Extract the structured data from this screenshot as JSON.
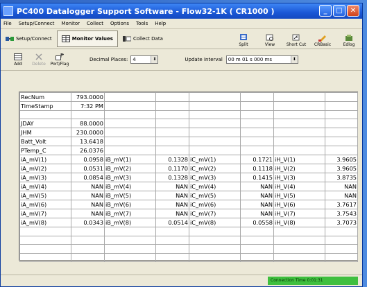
{
  "window": {
    "title": "PC400 Datalogger Support Software - Flow32-1K ( CR1000 )"
  },
  "menu": [
    "File",
    "Setup/Connect",
    "Monitor",
    "Collect",
    "Options",
    "Tools",
    "Help"
  ],
  "tabs": [
    {
      "label": "Setup/Connect",
      "active": false
    },
    {
      "label": "Monitor Values",
      "active": true
    },
    {
      "label": "Collect Data",
      "active": false
    }
  ],
  "right_tools": [
    {
      "label": "Split",
      "icon": "split-icon"
    },
    {
      "label": "View",
      "icon": "view-icon"
    },
    {
      "label": "Short Cut",
      "icon": "shortcut-icon"
    },
    {
      "label": "CRBasic",
      "icon": "crbasic-icon"
    },
    {
      "label": "Edlog",
      "icon": "edlog-icon"
    }
  ],
  "monitor_toolbar": {
    "add_label": "Add",
    "delete_label": "Delete",
    "portflag_label": "Port/Flag",
    "decimal_label": "Decimal Places:",
    "decimal_value": "4",
    "update_label": "Update Interval",
    "update_value": "00 m 01 s 000 ms"
  },
  "grid": {
    "rows": [
      [
        {
          "n": "RecNum",
          "v": "793.0000"
        },
        {
          "n": "",
          "v": ""
        },
        {
          "n": "",
          "v": ""
        },
        {
          "n": "",
          "v": ""
        }
      ],
      [
        {
          "n": "TimeStamp",
          "v": "7:32 PM"
        },
        {
          "n": "",
          "v": ""
        },
        {
          "n": "",
          "v": ""
        },
        {
          "n": "",
          "v": ""
        }
      ],
      [
        {
          "n": "",
          "v": ""
        },
        {
          "n": "",
          "v": ""
        },
        {
          "n": "",
          "v": ""
        },
        {
          "n": "",
          "v": ""
        }
      ],
      [
        {
          "n": "JDAY",
          "v": "88.0000"
        },
        {
          "n": "",
          "v": ""
        },
        {
          "n": "",
          "v": ""
        },
        {
          "n": "",
          "v": ""
        }
      ],
      [
        {
          "n": "JHM",
          "v": "230.0000"
        },
        {
          "n": "",
          "v": ""
        },
        {
          "n": "",
          "v": ""
        },
        {
          "n": "",
          "v": ""
        }
      ],
      [
        {
          "n": "Batt_Volt",
          "v": "13.6418"
        },
        {
          "n": "",
          "v": ""
        },
        {
          "n": "",
          "v": ""
        },
        {
          "n": "",
          "v": ""
        }
      ],
      [
        {
          "n": "PTemp_C",
          "v": "26.0376"
        },
        {
          "n": "",
          "v": ""
        },
        {
          "n": "",
          "v": ""
        },
        {
          "n": "",
          "v": ""
        }
      ],
      [
        {
          "n": "iA_mV(1)",
          "v": "0.0958"
        },
        {
          "n": "iB_mV(1)",
          "v": "0.1328"
        },
        {
          "n": "iC_mV(1)",
          "v": "0.1721"
        },
        {
          "n": "iH_V(1)",
          "v": "3.9605"
        }
      ],
      [
        {
          "n": "iA_mV(2)",
          "v": "0.0531"
        },
        {
          "n": "iB_mV(2)",
          "v": "0.1170"
        },
        {
          "n": "iC_mV(2)",
          "v": "0.1118"
        },
        {
          "n": "iH_V(2)",
          "v": "3.9605"
        }
      ],
      [
        {
          "n": "iA_mV(3)",
          "v": "0.0854"
        },
        {
          "n": "iB_mV(3)",
          "v": "0.1328"
        },
        {
          "n": "iC_mV(3)",
          "v": "0.1415"
        },
        {
          "n": "iH_V(3)",
          "v": "3.8735"
        }
      ],
      [
        {
          "n": "iA_mV(4)",
          "v": "NAN"
        },
        {
          "n": "iB_mV(4)",
          "v": "NAN"
        },
        {
          "n": "iC_mV(4)",
          "v": "NAN"
        },
        {
          "n": "iH_V(4)",
          "v": "NAN"
        }
      ],
      [
        {
          "n": "iA_mV(5)",
          "v": "NAN"
        },
        {
          "n": "iB_mV(5)",
          "v": "NAN"
        },
        {
          "n": "iC_mV(5)",
          "v": "NAN"
        },
        {
          "n": "iH_V(5)",
          "v": "NAN"
        }
      ],
      [
        {
          "n": "iA_mV(6)",
          "v": "NAN"
        },
        {
          "n": "iB_mV(6)",
          "v": "NAN"
        },
        {
          "n": "iC_mV(6)",
          "v": "NAN"
        },
        {
          "n": "iH_V(6)",
          "v": "3.7617"
        }
      ],
      [
        {
          "n": "iA_mV(7)",
          "v": "NAN"
        },
        {
          "n": "iB_mV(7)",
          "v": "NAN"
        },
        {
          "n": "iC_mV(7)",
          "v": "NAN"
        },
        {
          "n": "iH_V(7)",
          "v": "3.7543"
        }
      ],
      [
        {
          "n": "iA_mV(8)",
          "v": "0.0343"
        },
        {
          "n": "iB_mV(8)",
          "v": "0.0514"
        },
        {
          "n": "iC_mV(8)",
          "v": "0.0558"
        },
        {
          "n": "iH_V(8)",
          "v": "3.7073"
        }
      ],
      [
        {
          "n": "",
          "v": ""
        },
        {
          "n": "",
          "v": ""
        },
        {
          "n": "",
          "v": ""
        },
        {
          "n": "",
          "v": ""
        }
      ],
      [
        {
          "n": "",
          "v": ""
        },
        {
          "n": "",
          "v": ""
        },
        {
          "n": "",
          "v": ""
        },
        {
          "n": "",
          "v": ""
        }
      ],
      [
        {
          "n": "",
          "v": ""
        },
        {
          "n": "",
          "v": ""
        },
        {
          "n": "",
          "v": ""
        },
        {
          "n": "",
          "v": ""
        }
      ],
      [
        {
          "n": "",
          "v": ""
        },
        {
          "n": "",
          "v": ""
        },
        {
          "n": "",
          "v": ""
        },
        {
          "n": "",
          "v": ""
        }
      ]
    ]
  },
  "status": {
    "connection_label": "Connection Time 0:01:31"
  }
}
